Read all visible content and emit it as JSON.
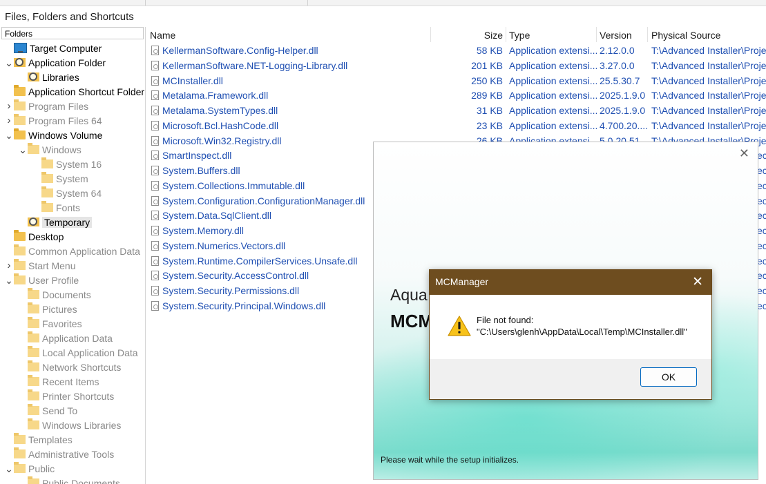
{
  "section_title": "Files, Folders and Shortcuts",
  "folders": {
    "header": "Folders",
    "items": [
      {
        "label": "Target Computer",
        "level": 0,
        "expander": "",
        "icon": "monitor-icon",
        "dim": false
      },
      {
        "label": "Application Folder",
        "level": 0,
        "expander": "expanded",
        "icon": "search-folder-icon",
        "dim": false
      },
      {
        "label": "Libraries",
        "level": 1,
        "expander": "",
        "icon": "search-folder-icon",
        "dim": false
      },
      {
        "label": "Application Shortcut Folder",
        "level": 0,
        "expander": "",
        "icon": "folder-icon",
        "dim": false
      },
      {
        "label": "Program Files",
        "level": 0,
        "expander": "collapsed",
        "icon": "folder-icon",
        "dim": true
      },
      {
        "label": "Program Files 64",
        "level": 0,
        "expander": "collapsed",
        "icon": "folder-icon",
        "dim": true
      },
      {
        "label": "Windows Volume",
        "level": 0,
        "expander": "expanded",
        "icon": "folder-icon",
        "dim": false
      },
      {
        "label": "Windows",
        "level": 1,
        "expander": "expanded",
        "icon": "folder-icon",
        "dim": true
      },
      {
        "label": "System 16",
        "level": 2,
        "expander": "",
        "icon": "folder-icon",
        "dim": true
      },
      {
        "label": "System",
        "level": 2,
        "expander": "",
        "icon": "folder-icon",
        "dim": true
      },
      {
        "label": "System 64",
        "level": 2,
        "expander": "",
        "icon": "folder-icon",
        "dim": true
      },
      {
        "label": "Fonts",
        "level": 2,
        "expander": "",
        "icon": "folder-icon",
        "dim": true
      },
      {
        "label": "Temporary",
        "level": 1,
        "expander": "",
        "icon": "search-folder-icon",
        "dim": false,
        "selected": true
      },
      {
        "label": "Desktop",
        "level": 0,
        "expander": "",
        "icon": "folder-icon",
        "dim": false
      },
      {
        "label": "Common Application Data",
        "level": 0,
        "expander": "",
        "icon": "folder-icon",
        "dim": true
      },
      {
        "label": "Start Menu",
        "level": 0,
        "expander": "collapsed",
        "icon": "folder-icon",
        "dim": true
      },
      {
        "label": "User Profile",
        "level": 0,
        "expander": "expanded",
        "icon": "folder-icon",
        "dim": true
      },
      {
        "label": "Documents",
        "level": 1,
        "expander": "",
        "icon": "folder-icon",
        "dim": true
      },
      {
        "label": "Pictures",
        "level": 1,
        "expander": "",
        "icon": "folder-icon",
        "dim": true
      },
      {
        "label": "Favorites",
        "level": 1,
        "expander": "",
        "icon": "folder-icon",
        "dim": true
      },
      {
        "label": "Application Data",
        "level": 1,
        "expander": "",
        "icon": "folder-icon",
        "dim": true
      },
      {
        "label": "Local Application Data",
        "level": 1,
        "expander": "",
        "icon": "folder-icon",
        "dim": true
      },
      {
        "label": "Network Shortcuts",
        "level": 1,
        "expander": "",
        "icon": "folder-icon",
        "dim": true
      },
      {
        "label": "Recent Items",
        "level": 1,
        "expander": "",
        "icon": "folder-icon",
        "dim": true
      },
      {
        "label": "Printer Shortcuts",
        "level": 1,
        "expander": "",
        "icon": "folder-icon",
        "dim": true
      },
      {
        "label": "Send To",
        "level": 1,
        "expander": "",
        "icon": "folder-icon",
        "dim": true
      },
      {
        "label": "Windows Libraries",
        "level": 1,
        "expander": "",
        "icon": "folder-icon",
        "dim": true
      },
      {
        "label": "Templates",
        "level": 0,
        "expander": "",
        "icon": "folder-icon",
        "dim": true
      },
      {
        "label": "Administrative Tools",
        "level": 0,
        "expander": "",
        "icon": "folder-icon",
        "dim": true
      },
      {
        "label": "Public",
        "level": 0,
        "expander": "expanded",
        "icon": "folder-icon",
        "dim": true
      },
      {
        "label": "Public Documents",
        "level": 1,
        "expander": "",
        "icon": "folder-icon",
        "dim": true
      }
    ]
  },
  "file_list": {
    "columns": {
      "name": "Name",
      "size": "Size",
      "type": "Type",
      "version": "Version",
      "source": "Physical Source"
    },
    "rows": [
      {
        "name": "KellermanSoftware.Config-Helper.dll",
        "size": "58 KB",
        "type": "Application extensi...",
        "version": "2.12.0.0",
        "source": "T:\\Advanced Installer\\Projec"
      },
      {
        "name": "KellermanSoftware.NET-Logging-Library.dll",
        "size": "201 KB",
        "type": "Application extensi...",
        "version": "3.27.0.0",
        "source": "T:\\Advanced Installer\\Projec"
      },
      {
        "name": "MCInstaller.dll",
        "size": "250 KB",
        "type": "Application extensi...",
        "version": "25.5.30.7",
        "source": "T:\\Advanced Installer\\Projec"
      },
      {
        "name": "Metalama.Framework.dll",
        "size": "289 KB",
        "type": "Application extensi...",
        "version": "2025.1.9.0",
        "source": "T:\\Advanced Installer\\Projec"
      },
      {
        "name": "Metalama.SystemTypes.dll",
        "size": "31 KB",
        "type": "Application extensi...",
        "version": "2025.1.9.0",
        "source": "T:\\Advanced Installer\\Projec"
      },
      {
        "name": "Microsoft.Bcl.HashCode.dll",
        "size": "23 KB",
        "type": "Application extensi...",
        "version": "4.700.20....",
        "source": "T:\\Advanced Installer\\Projec"
      },
      {
        "name": "Microsoft.Win32.Registry.dll",
        "size": "26 KB",
        "type": "Application extensi...",
        "version": "5.0.20.51...",
        "source": "T:\\Advanced Installer\\Projec"
      },
      {
        "name": "SmartInspect.dll",
        "size": "",
        "type": "",
        "version": "",
        "source": "ec"
      },
      {
        "name": "System.Buffers.dll",
        "size": "",
        "type": "",
        "version": "",
        "source": "ec"
      },
      {
        "name": "System.Collections.Immutable.dll",
        "size": "",
        "type": "",
        "version": "",
        "source": "ec"
      },
      {
        "name": "System.Configuration.ConfigurationManager.dll",
        "size": "",
        "type": "",
        "version": "",
        "source": "ec"
      },
      {
        "name": "System.Data.SqlClient.dll",
        "size": "",
        "type": "",
        "version": "",
        "source": "ec"
      },
      {
        "name": "System.Memory.dll",
        "size": "",
        "type": "",
        "version": "",
        "source": "ec"
      },
      {
        "name": "System.Numerics.Vectors.dll",
        "size": "",
        "type": "",
        "version": "",
        "source": "ec"
      },
      {
        "name": "System.Runtime.CompilerServices.Unsafe.dll",
        "size": "",
        "type": "",
        "version": "",
        "source": "ec"
      },
      {
        "name": "System.Security.AccessControl.dll",
        "size": "",
        "type": "",
        "version": "",
        "source": "ec"
      },
      {
        "name": "System.Security.Permissions.dll",
        "size": "",
        "type": "",
        "version": "",
        "source": "ec"
      },
      {
        "name": "System.Security.Principal.Windows.dll",
        "size": "",
        "type": "",
        "version": "",
        "source": "ec"
      }
    ]
  },
  "setup_window": {
    "text1": "Aqua",
    "text2": "MCM",
    "status": "Please wait while the setup initializes.",
    "close_glyph": "✕"
  },
  "message_box": {
    "title": "MCManager",
    "close_glyph": "✕",
    "line1": "File not found:",
    "line2": "\"C:\\Users\\glenh\\AppData\\Local\\Temp\\MCInstaller.dll\"",
    "ok_label": "OK",
    "title_color": "#6e4d1f"
  }
}
